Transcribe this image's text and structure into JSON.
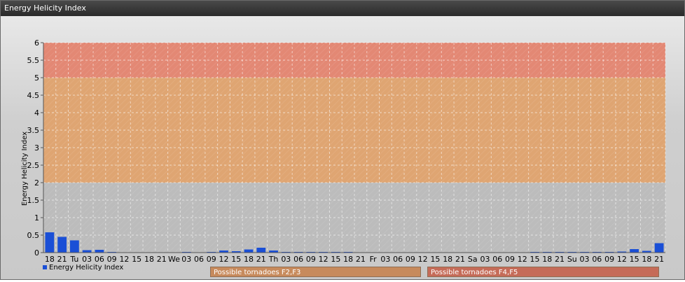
{
  "window": {
    "title": "Energy Helicity Index"
  },
  "legend": {
    "series_label": "Energy Helicity Index",
    "zones": [
      {
        "label": "Possible tornadoes F2,F3",
        "color": "#c78a5c"
      },
      {
        "label": "Possible tornadoes F4,F5",
        "color": "#c56b58"
      }
    ]
  },
  "colors": {
    "bar": "#1a4fd6",
    "zone_low": "#bcbcbc",
    "zone_mid": "#dfa572",
    "zone_high": "#e38874"
  },
  "chart_data": {
    "type": "bar",
    "ylabel": "Energy Helicity Index",
    "ylim": [
      0,
      6
    ],
    "yticks": [
      "0",
      "0.5",
      "1",
      "1.5",
      "2",
      "2.5",
      "3",
      "3.5",
      "4",
      "4.5",
      "5",
      "5.5",
      "6"
    ],
    "grid": true,
    "bands": [
      {
        "from": 0,
        "to": 2,
        "color": "#bcbcbc"
      },
      {
        "from": 2,
        "to": 5,
        "color": "#dfa572"
      },
      {
        "from": 5,
        "to": 6,
        "color": "#e38874"
      }
    ],
    "categories": [
      "18",
      "21",
      "Tu",
      "03",
      "06",
      "09",
      "12",
      "15",
      "18",
      "21",
      "We",
      "03",
      "06",
      "09",
      "12",
      "15",
      "18",
      "21",
      "Th",
      "03",
      "06",
      "09",
      "12",
      "15",
      "18",
      "21",
      "Fr",
      "03",
      "06",
      "09",
      "12",
      "15",
      "18",
      "21",
      "Sa",
      "03",
      "06",
      "09",
      "12",
      "15",
      "18",
      "21",
      "Su",
      "03",
      "06",
      "09",
      "12",
      "15",
      "18",
      "21"
    ],
    "series": [
      {
        "name": "Energy Helicity Index",
        "values": [
          0.58,
          0.45,
          0.35,
          0.07,
          0.08,
          0.02,
          0.01,
          0.01,
          0.01,
          0.01,
          0.01,
          0.02,
          0.01,
          0.02,
          0.06,
          0.04,
          0.09,
          0.14,
          0.06,
          0.02,
          0.02,
          0.02,
          0.02,
          0.02,
          0.02,
          0.01,
          0.01,
          0.01,
          0.01,
          0.01,
          0.01,
          0.01,
          0.01,
          0.01,
          0.01,
          0.01,
          0.01,
          0.01,
          0.01,
          0.02,
          0.02,
          0.02,
          0.02,
          0.02,
          0.02,
          0.02,
          0.03,
          0.1,
          0.05,
          0.27
        ]
      }
    ]
  }
}
